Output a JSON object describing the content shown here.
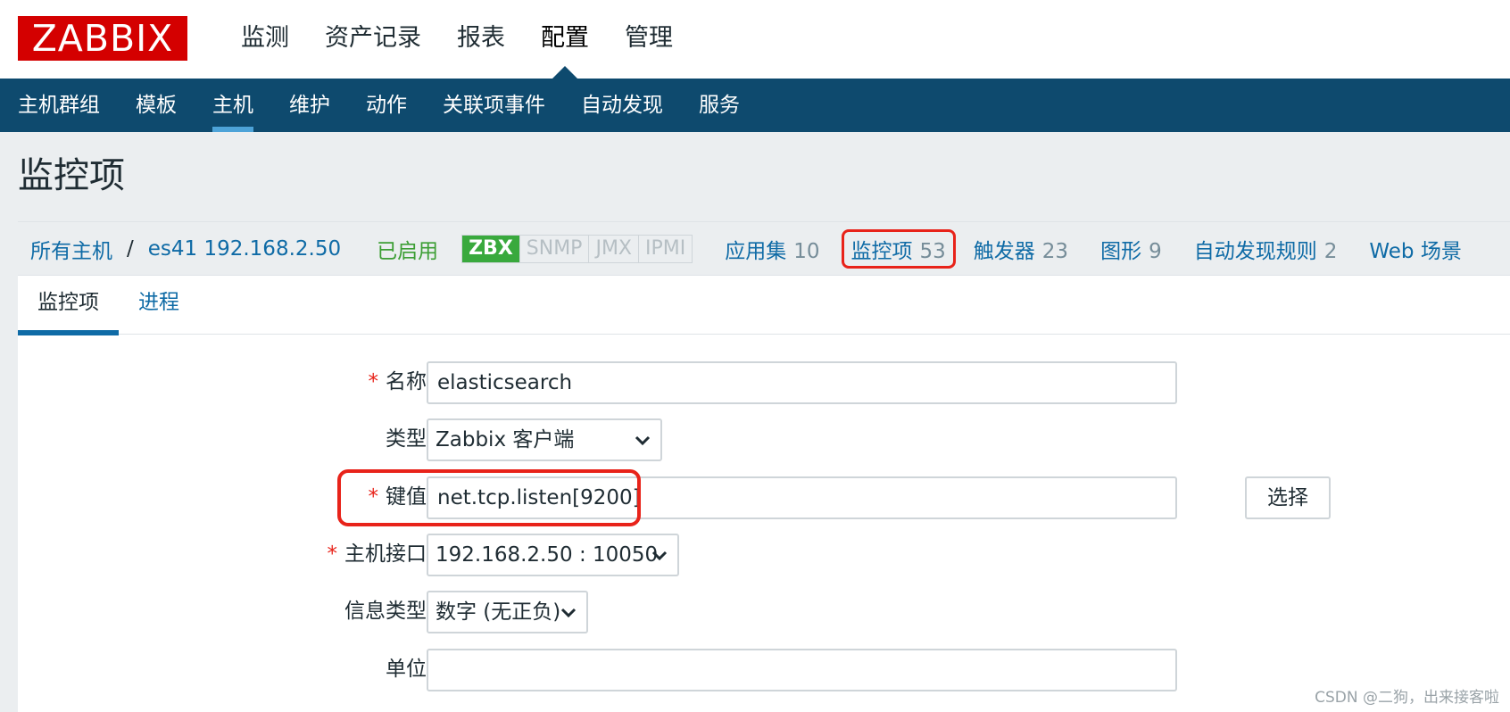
{
  "header": {
    "logo": "ZABBIX",
    "main_nav": [
      "监测",
      "资产记录",
      "报表",
      "配置",
      "管理"
    ],
    "main_nav_active": "配置"
  },
  "subnav": {
    "items": [
      "主机群组",
      "模板",
      "主机",
      "维护",
      "动作",
      "关联项事件",
      "自动发现",
      "服务"
    ],
    "active": "主机"
  },
  "page_title": "监控项",
  "breadcrumb": {
    "all_hosts": "所有主机",
    "separator": "/",
    "host": "es41 192.168.2.50",
    "status": "已启用",
    "availability": [
      "ZBX",
      "SNMP",
      "JMX",
      "IPMI"
    ],
    "availability_on": "ZBX",
    "tabs": [
      {
        "label": "应用集",
        "count": "10"
      },
      {
        "label": "监控项",
        "count": "53"
      },
      {
        "label": "触发器",
        "count": "23"
      },
      {
        "label": "图形",
        "count": "9"
      },
      {
        "label": "自动发现规则",
        "count": "2"
      },
      {
        "label": "Web 场景",
        "count": ""
      }
    ]
  },
  "form_tabs": [
    "监控项",
    "进程"
  ],
  "form": {
    "name_label": "名称",
    "name_value": "elasticsearch",
    "type_label": "类型",
    "type_value": "Zabbix 客户端",
    "key_label": "键值",
    "key_value": "net.tcp.listen[9200]",
    "select_button": "选择",
    "interface_label": "主机接口",
    "interface_value": "192.168.2.50 : 10050",
    "info_type_label": "信息类型",
    "info_type_value": "数字 (无正负)",
    "units_label": "单位",
    "units_value": "",
    "required_mark": "*"
  },
  "watermark": "CSDN @二狗，出来接客啦",
  "colors": {
    "logo_red": "#d40000",
    "nav_blue": "#0e4a6e",
    "link_blue": "#0f6ba6",
    "enabled_green": "#3c9e34",
    "highlight_red": "#e8231a"
  }
}
